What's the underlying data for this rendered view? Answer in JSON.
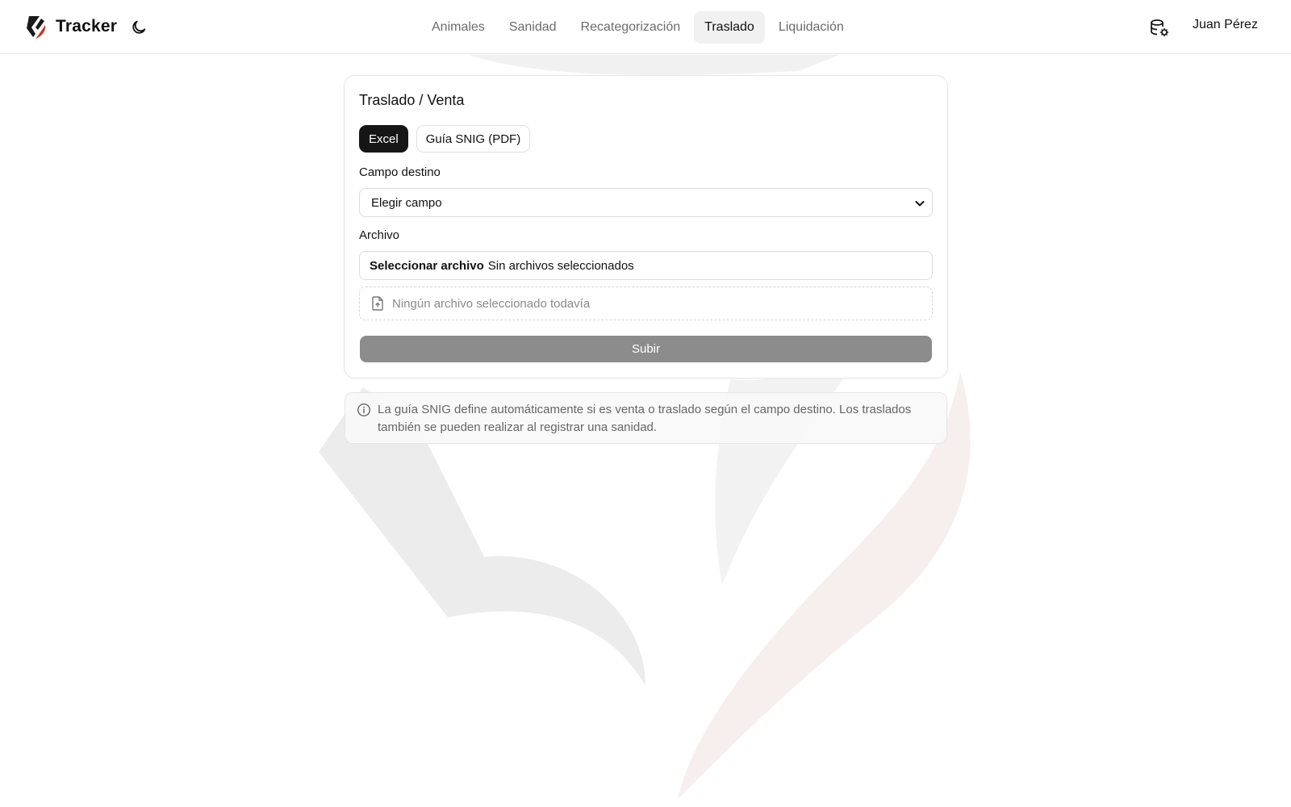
{
  "header": {
    "brand_name": "Tracker",
    "nav": [
      {
        "label": "Animales",
        "active": false
      },
      {
        "label": "Sanidad",
        "active": false
      },
      {
        "label": "Recategorización",
        "active": false
      },
      {
        "label": "Traslado",
        "active": true
      },
      {
        "label": "Liquidación",
        "active": false
      }
    ],
    "user_name": "Juan Pérez",
    "icons": {
      "theme": "moon-icon",
      "settings": "database-settings-icon"
    }
  },
  "card": {
    "title": "Traslado / Venta",
    "tabs": [
      {
        "label": "Excel",
        "active": true
      },
      {
        "label": "Guía SNIG (PDF)",
        "active": false
      }
    ],
    "destination": {
      "label": "Campo destino",
      "selected": "Elegir campo"
    },
    "file": {
      "label": "Archivo",
      "button_text": "Seleccionar archivo",
      "status_text": "Sin archivos seleccionados",
      "dropzone_text": "Ningún archivo seleccionado todavía"
    },
    "submit_label": "Subir"
  },
  "info": {
    "text": "La guía SNIG define automáticamente si es venta o traslado según el campo destino. Los traslados también se pueden realizar al registrar una sanidad."
  },
  "colors": {
    "accent_dark": "#161616",
    "submit_disabled": "#8c8c8c",
    "logo_red": "#c0392b"
  }
}
